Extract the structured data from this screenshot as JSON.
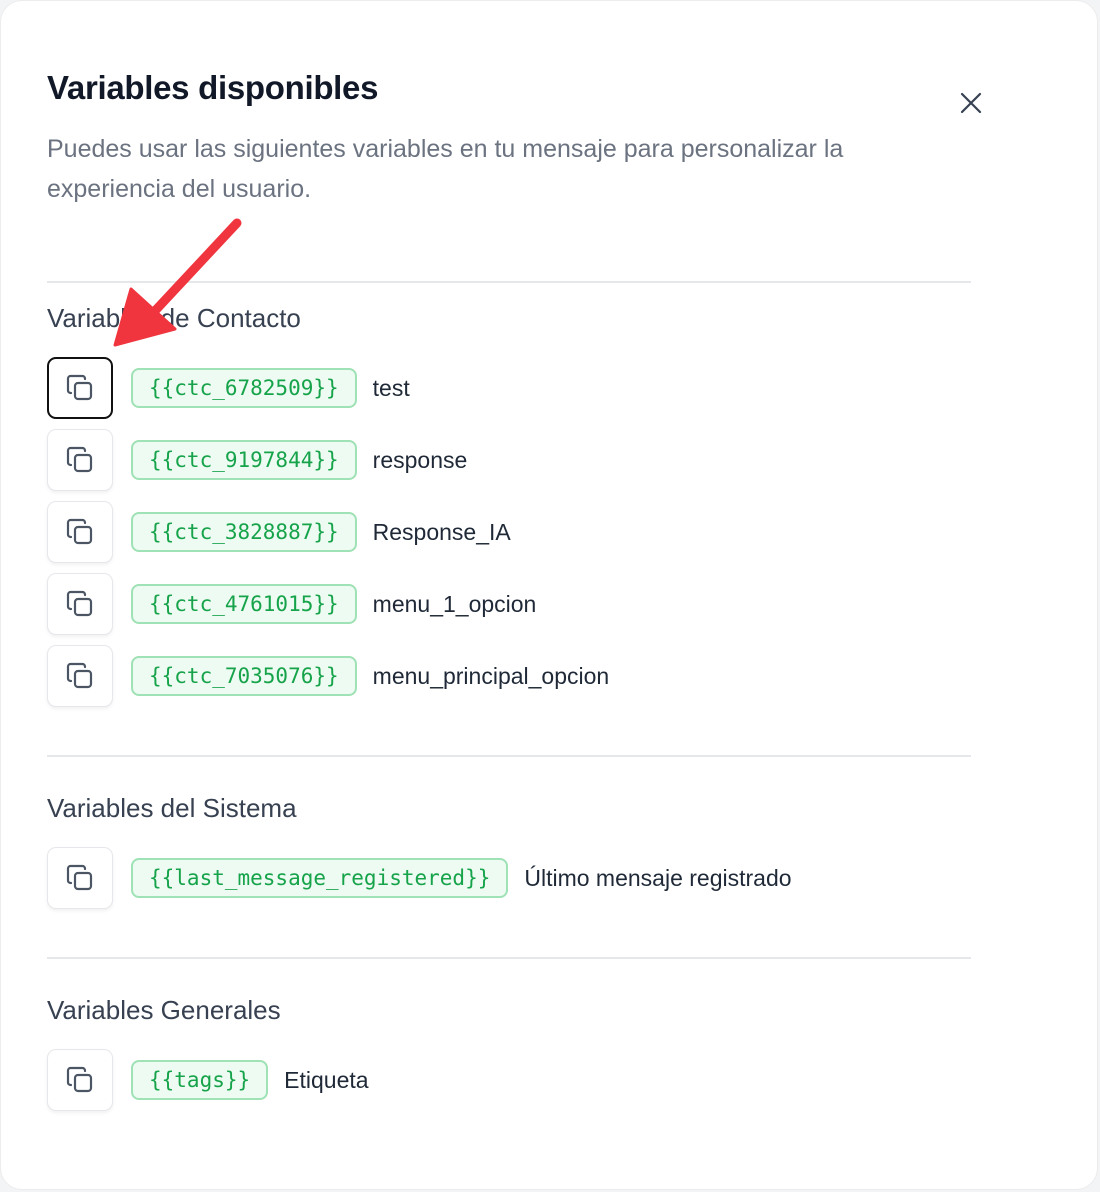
{
  "modal": {
    "title": "Variables disponibles",
    "subtitle": "Puedes usar las siguientes variables en tu mensaje para personalizar la experiencia del usuario.",
    "close_icon": "close-icon"
  },
  "sections": {
    "contact": {
      "title": "Variables de Contacto",
      "items": [
        {
          "tag": "{{ctc_6782509}}",
          "label": "test"
        },
        {
          "tag": "{{ctc_9197844}}",
          "label": "response"
        },
        {
          "tag": "{{ctc_3828887}}",
          "label": "Response_IA"
        },
        {
          "tag": "{{ctc_4761015}}",
          "label": "menu_1_opcion"
        },
        {
          "tag": "{{ctc_7035076}}",
          "label": "menu_principal_opcion"
        }
      ]
    },
    "system": {
      "title": "Variables del Sistema",
      "items": [
        {
          "tag": "{{last_message_registered}}",
          "label": "Último mensaje registrado"
        }
      ]
    },
    "general": {
      "title": "Variables Generales",
      "items": [
        {
          "tag": "{{tags}}",
          "label": "Etiqueta"
        }
      ]
    }
  },
  "icons": {
    "copy": "copy-icon",
    "annotation": "red-arrow-annotation"
  },
  "colors": {
    "tag_text": "#16a34a",
    "tag_border": "#9ee2b5",
    "tag_bg": "#edfbf2",
    "annotation_arrow": "#f0353f"
  }
}
